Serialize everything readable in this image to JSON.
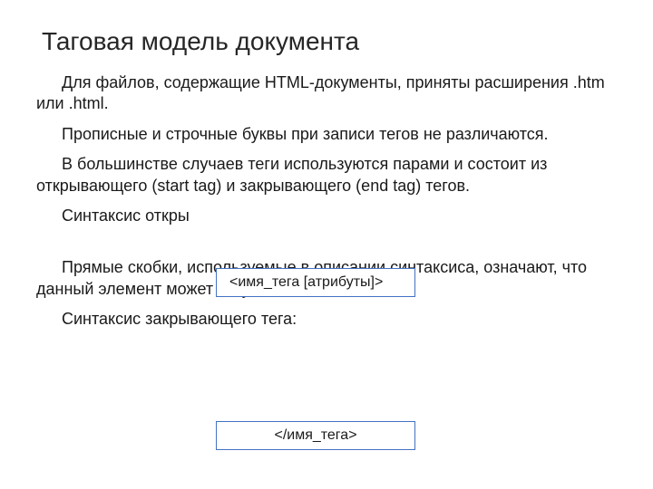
{
  "title": "Таговая модель документа",
  "paragraphs": {
    "p1": "Для файлов, содержащие HTML-документы, приняты расширения .htm или .html.",
    "p2": "Прописные и строчные буквы при записи тегов не различаются.",
    "p3": " В большинстве случаев теги используются парами и состоит из открывающего (start tag) и закрывающего (end tag) тегов.",
    "p4": "Синтаксис откры",
    "p5": "Прямые скобки, используемые в описании синтаксиса, означают, что данный элемент может отсутствовать.",
    "p6": "Синтаксис закрывающего тега:"
  },
  "syntax_boxes": {
    "open_tag": "<имя_тега [атрибуты]>",
    "close_tag": "</имя_тега>"
  }
}
